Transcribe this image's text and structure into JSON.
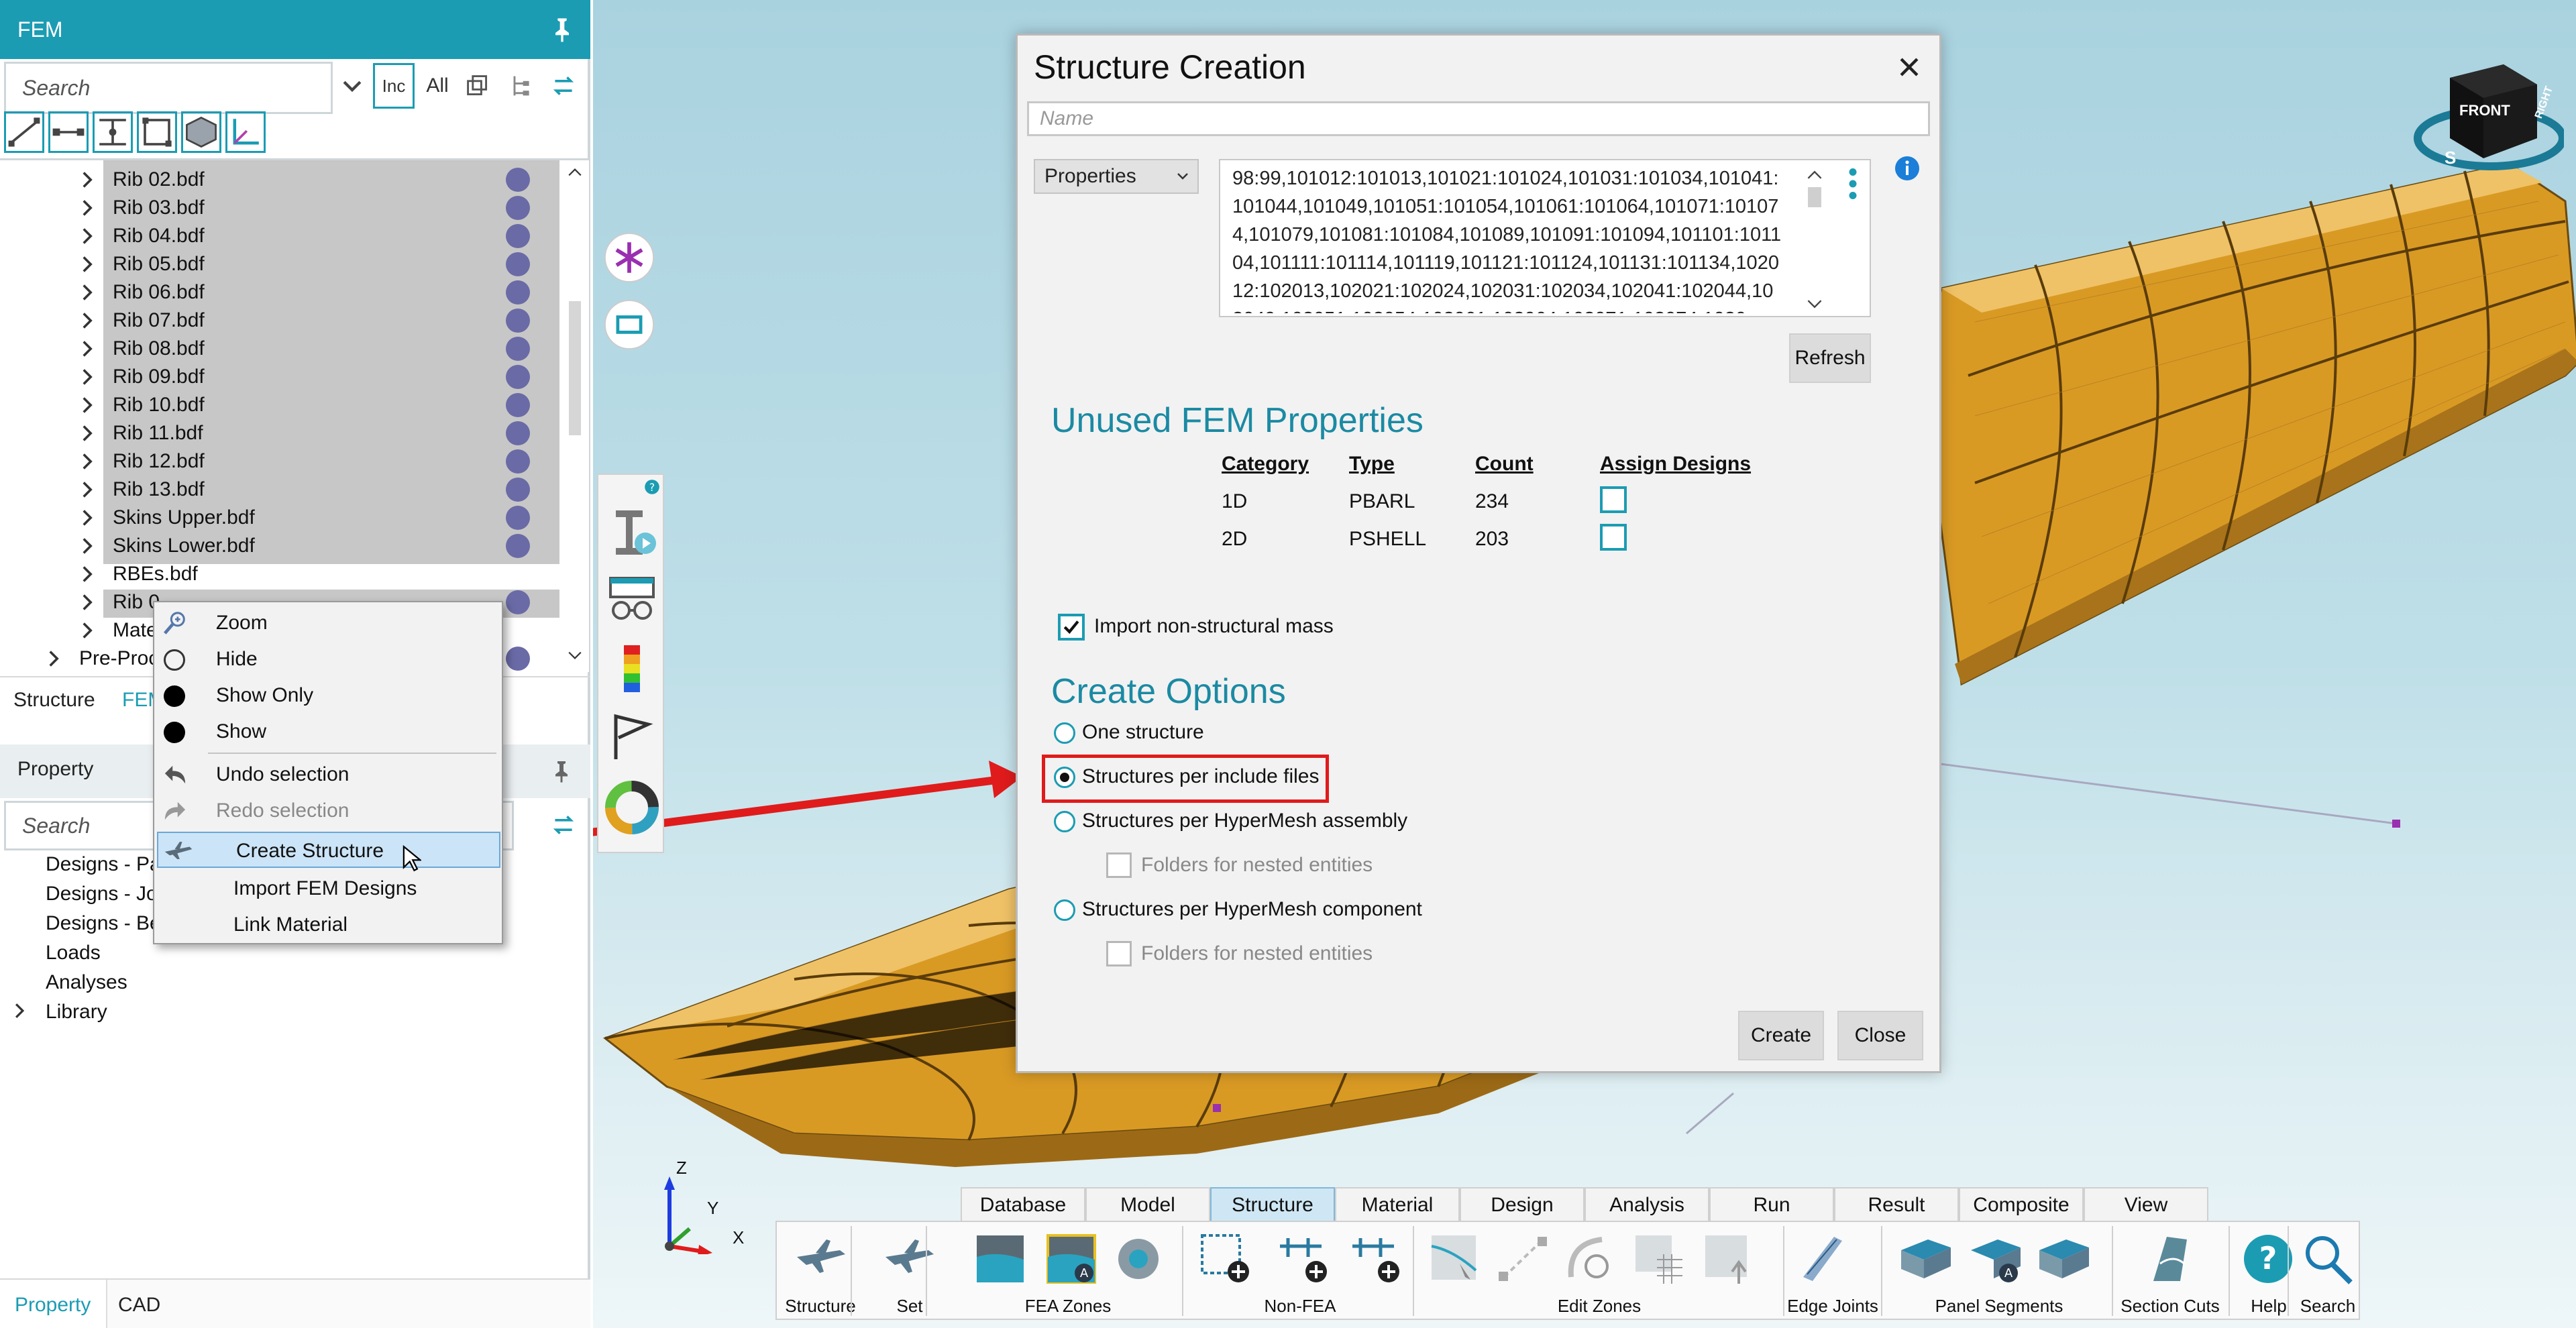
{
  "left_panel": {
    "title": "FEM",
    "search_placeholder": "Search",
    "filter_buttons": {
      "inc": "Inc",
      "all": "All"
    },
    "tree_items": [
      {
        "label": "Rib 02.bdf"
      },
      {
        "label": "Rib 03.bdf"
      },
      {
        "label": "Rib 04.bdf"
      },
      {
        "label": "Rib 05.bdf"
      },
      {
        "label": "Rib 06.bdf"
      },
      {
        "label": "Rib 07.bdf"
      },
      {
        "label": "Rib 08.bdf"
      },
      {
        "label": "Rib 09.bdf"
      },
      {
        "label": "Rib 10.bdf"
      },
      {
        "label": "Rib 11.bdf"
      },
      {
        "label": "Rib 12.bdf"
      },
      {
        "label": "Rib 13.bdf"
      },
      {
        "label": "Skins Upper.bdf"
      },
      {
        "label": "Skins Lower.bdf"
      },
      {
        "label": "RBEs.bdf"
      },
      {
        "label": "Rib 0"
      },
      {
        "label": "Mate"
      }
    ],
    "pre_proc_label": "Pre-Proc",
    "tabs": {
      "structure": "Structure",
      "fem": "FEM"
    },
    "property_title": "Property",
    "property_search_placeholder": "Search",
    "property_items": [
      "Designs - Pa",
      "Designs - Jo",
      "Designs - Be",
      "Loads",
      "Analyses",
      "Library"
    ],
    "bottom_tabs": {
      "property": "Property",
      "cad": "CAD"
    }
  },
  "context_menu": {
    "items": [
      {
        "label": "Zoom",
        "icon": "zoom-icon"
      },
      {
        "label": "Hide",
        "icon": "hide-icon"
      },
      {
        "label": "Show Only",
        "icon": "show-only-icon"
      },
      {
        "label": "Show",
        "icon": "show-icon"
      },
      {
        "label": "Undo selection",
        "icon": "undo-icon"
      },
      {
        "label": "Redo selection",
        "icon": "redo-icon"
      },
      {
        "label": "Create Structure",
        "icon": "create-structure-icon"
      },
      {
        "label": "Import FEM Designs"
      },
      {
        "label": "Link Material"
      }
    ]
  },
  "dialog": {
    "title": "Structure Creation",
    "name_placeholder": "Name",
    "properties_select": "Properties",
    "id_list": "98:99,101012:101013,101021:101024,101031:101034,101041:101044,101049,101051:101054,101061:101064,101071:101074,101079,101081:101084,101089,101091:101094,101101:101104,101111:101114,101119,101121:101124,101131:101134,102012:102013,102021:102024,102031:102034,102041:102044,102049,102051:102054,102061:102064,102071:102074,1020",
    "refresh_label": "Refresh",
    "unused_title": "Unused FEM Properties",
    "table": {
      "headers": [
        "Category",
        "Type",
        "Count",
        "Assign Designs"
      ],
      "rows": [
        {
          "category": "1D",
          "type": "PBARL",
          "count": "234"
        },
        {
          "category": "2D",
          "type": "PSHELL",
          "count": "203"
        }
      ]
    },
    "import_mass_label": "Import non-structural mass",
    "create_options_title": "Create Options",
    "options": {
      "one": "One structure",
      "include": "Structures per include files",
      "assembly": "Structures per HyperMesh assembly",
      "folders1": "Folders for nested entities",
      "component": "Structures per HyperMesh component",
      "folders2": "Folders for nested entities"
    },
    "selected_option": "Structures per include files",
    "create_label": "Create",
    "close_label": "Close"
  },
  "viewcube": {
    "front": "FRONT",
    "right": "RIGHT",
    "s": "S"
  },
  "axes": {
    "x": "X",
    "y": "Y",
    "z": "Z"
  },
  "ribbon": {
    "tabs": [
      "Database",
      "Model",
      "Structure",
      "Material",
      "Design",
      "Analysis",
      "Run",
      "Result",
      "Composite",
      "View"
    ],
    "active_tab": "Structure",
    "groups": [
      "Structure",
      "Set",
      "FEA Zones",
      "Non-FEA",
      "Edit Zones",
      "Edge Joints",
      "Panel Segments",
      "Section Cuts",
      "Help",
      "Search"
    ]
  },
  "colors": {
    "accent": "#1b9cb3",
    "wing": "#e2a32a",
    "highlight": "#e01b1b"
  }
}
